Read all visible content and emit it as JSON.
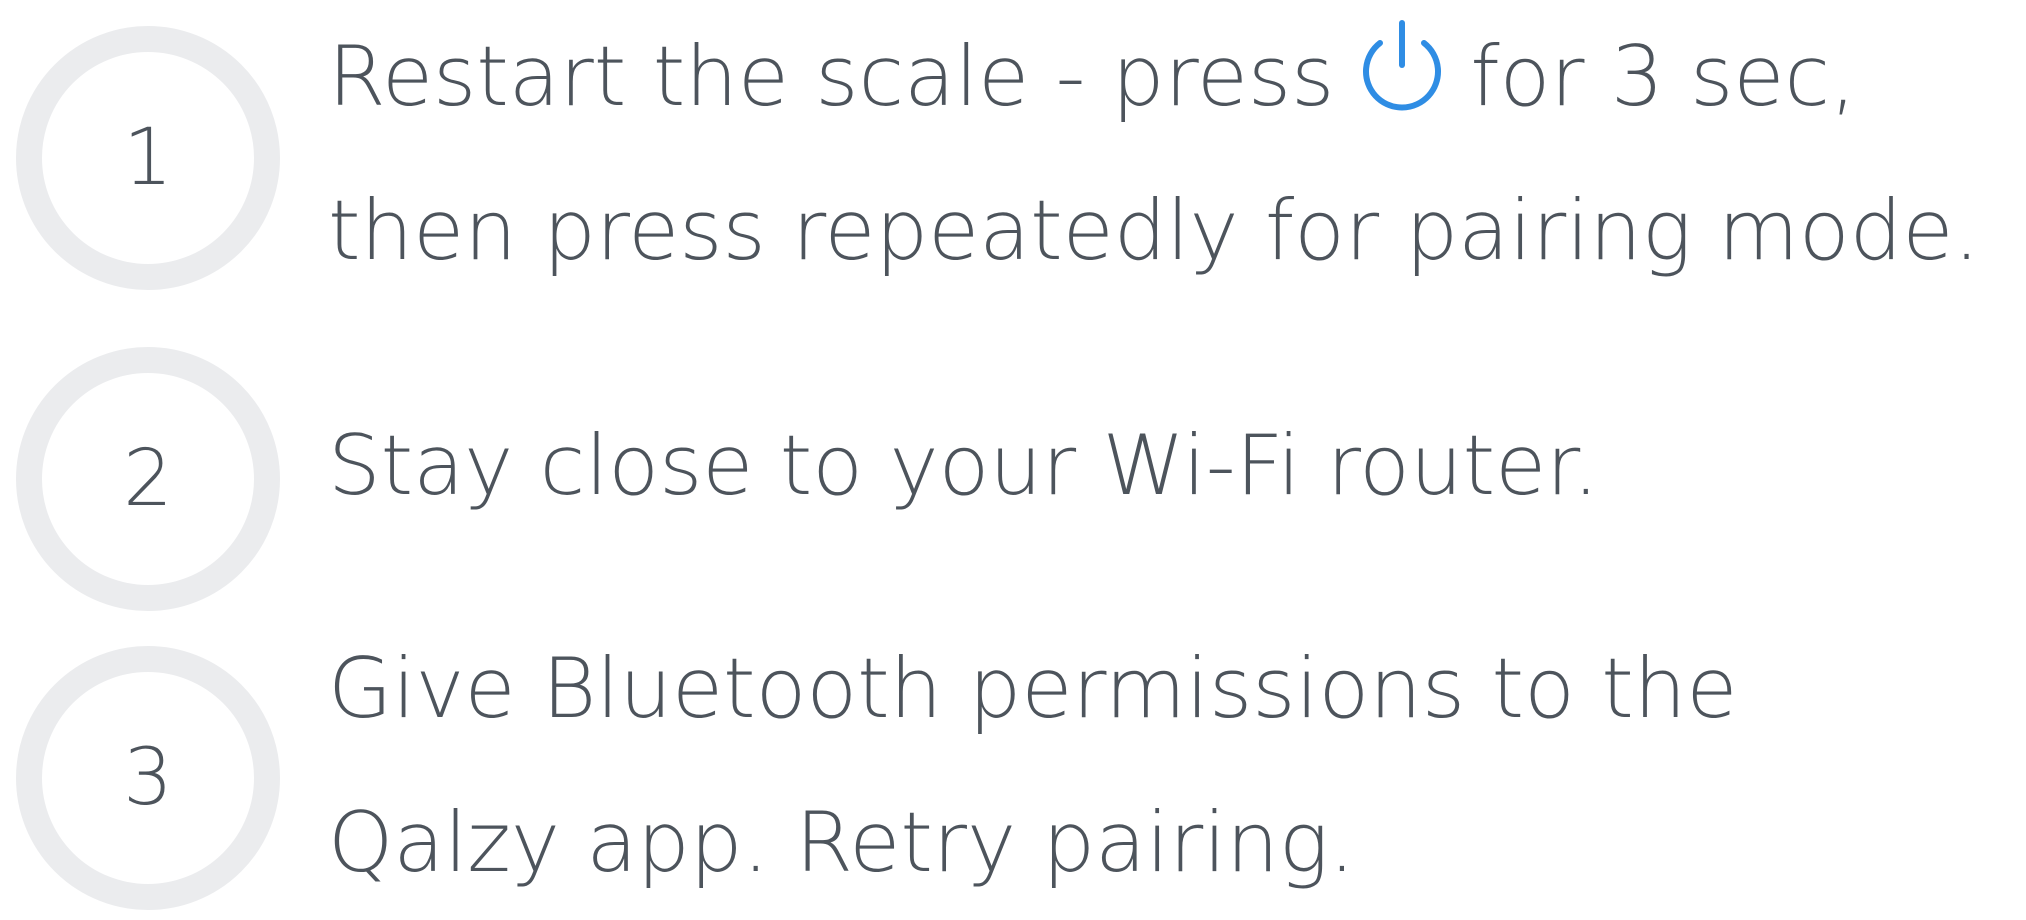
{
  "colors": {
    "text": "#4d545c",
    "circle_ring": "#ebecee",
    "accent": "#2f8de4",
    "background": "#ffffff"
  },
  "steps": [
    {
      "number": "1",
      "line1_before_icon": "Restart the scale - press",
      "icon": "power-icon",
      "line1_after_icon": "for 3 sec,",
      "line2": "then press repeatedly for pairing mode."
    },
    {
      "number": "2",
      "line1": "Stay close to your Wi-Fi router."
    },
    {
      "number": "3",
      "line1": "Give Bluetooth permissions to the",
      "line2": "Qalzy app. Retry pairing."
    }
  ]
}
